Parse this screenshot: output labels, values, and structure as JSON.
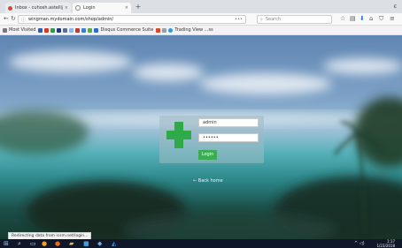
{
  "browser": {
    "tabs": [
      {
        "label": "Inbox - cuhosh.astell@gmail...",
        "active": false
      },
      {
        "label": "Login",
        "active": true
      }
    ],
    "url": "wingman.mydomain.com/shop/admin/",
    "search_placeholder": "Search",
    "bookmarks": [
      "Most Visited",
      "Disqus Commerce Suite",
      "Trading View ...ss"
    ]
  },
  "login": {
    "username_value": "admin",
    "password_value": "••••••",
    "button_label": "Login",
    "back_link": "← Back home"
  },
  "status_url": "Redirecting data from icsm.net/login...",
  "clock": {
    "time": "1:17",
    "date": "1/23/2018"
  },
  "colors": {
    "login_button": "#3cad55",
    "logo": "#2eaa48",
    "taskbar": "#10172b"
  }
}
